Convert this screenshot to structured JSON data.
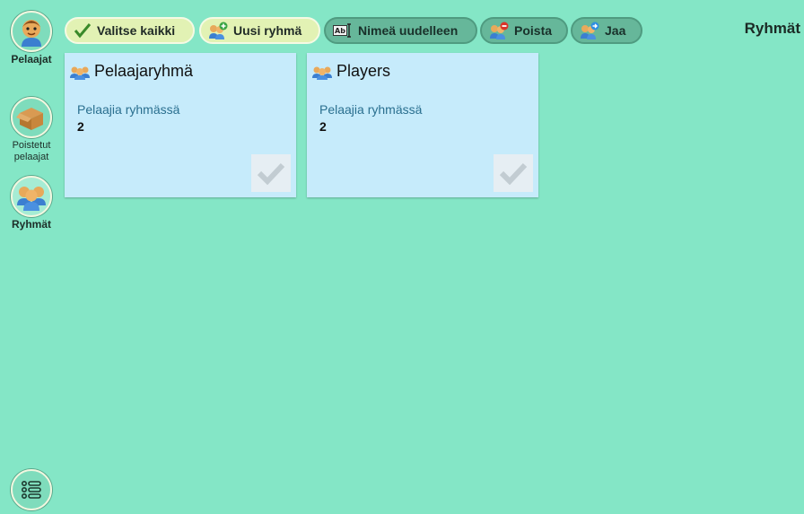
{
  "sidebar": {
    "items": [
      {
        "label": "Pelaajat",
        "icon": "player-face-icon"
      },
      {
        "label": "Poistetut pelaajat",
        "icon": "cardboard-box-icon"
      },
      {
        "label": "Ryhmät",
        "icon": "group-icon"
      }
    ],
    "bottom_icon": "list-menu-icon"
  },
  "toolbar": {
    "select_all": "Valitse kaikki",
    "new_group": "Uusi ryhmä",
    "rename": "Nimeä uudelleen",
    "delete": "Poista",
    "share": "Jaa"
  },
  "page_title": "Ryhmät",
  "groups": [
    {
      "name": "Pelaajaryhmä",
      "subtitle": "Pelaajia ryhmässä",
      "count": "2"
    },
    {
      "name": "Players",
      "subtitle": "Pelaajia ryhmässä",
      "count": "2"
    }
  ],
  "colors": {
    "background": "#84e6c6",
    "card": "#c6ebfb",
    "active_button": "#e2f2b4",
    "disabled_button": "#66b79a"
  }
}
